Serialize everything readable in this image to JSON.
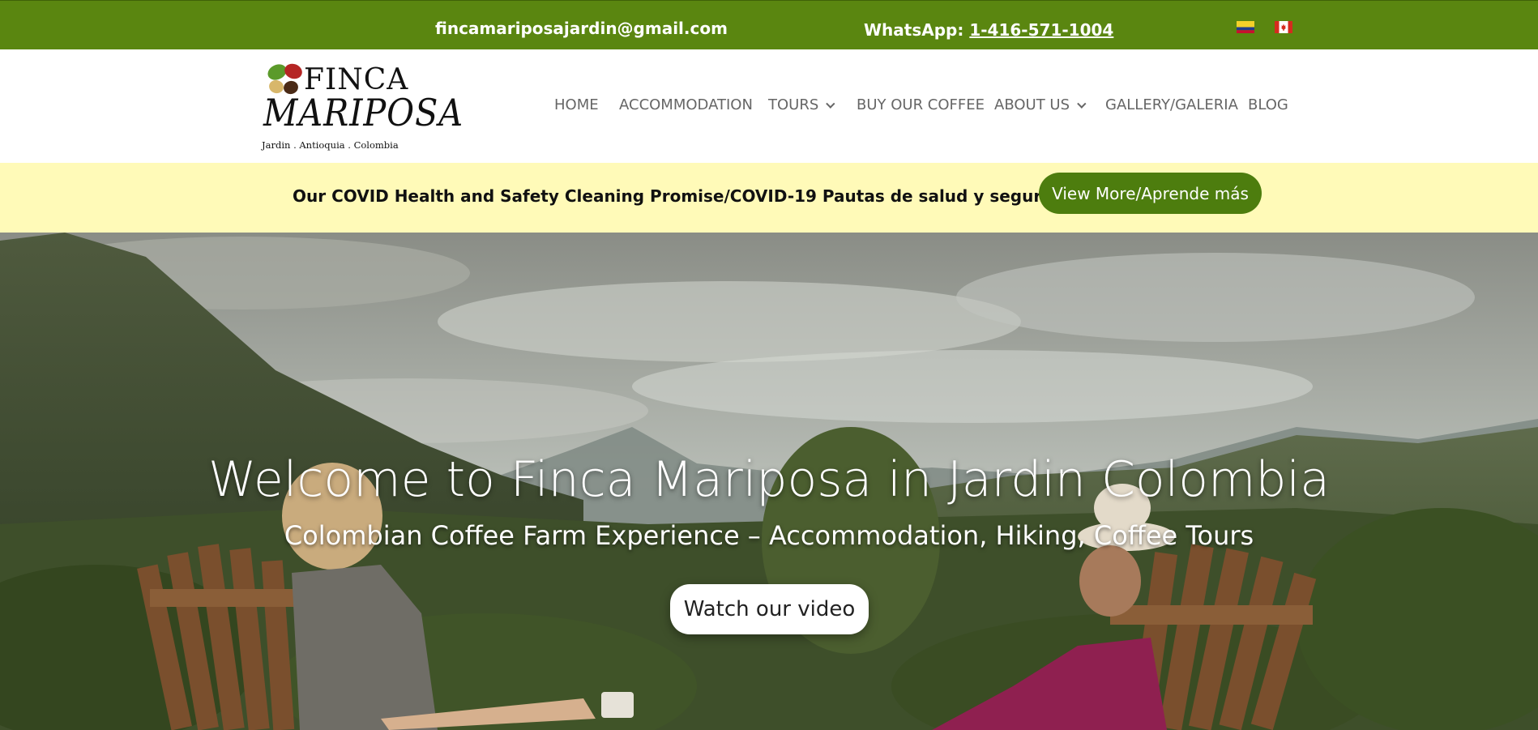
{
  "topbar": {
    "email": "fincamariposajardin@gmail.com",
    "whatsapp_label": "WhatsApp: ",
    "whatsapp_phone": "1-416-571-1004",
    "flags": [
      "colombia-flag",
      "canada-flag"
    ]
  },
  "logo": {
    "line1": "FINCA",
    "line2": "MARIPOSA",
    "tagline": "Jardin . Antioquia . Colombia"
  },
  "nav": {
    "items": [
      {
        "label": "HOME"
      },
      {
        "label": "ACCOMMODATION"
      },
      {
        "label": "TOURS"
      },
      {
        "label": "BUY OUR COFFEE"
      },
      {
        "label": "ABOUT US"
      },
      {
        "label": "GALLERY/GALERIA"
      },
      {
        "label": "BLOG"
      }
    ]
  },
  "covid": {
    "text": "Our COVID Health and Safety Cleaning Promise/COVID-19 Pautas de salud y seguridad",
    "button": "View More/Aprende más"
  },
  "hero": {
    "title": "Welcome to Finca Mariposa in Jardin Colombia",
    "subtitle": "Colombian Coffee Farm Experience – Accommodation, Hiking, Coffee Tours",
    "button": "Watch our video"
  },
  "colors": {
    "topbar": "#5a8610",
    "accent_button": "#4d7d0e",
    "covid_bg": "#fffab8",
    "nav_text": "#666666"
  }
}
